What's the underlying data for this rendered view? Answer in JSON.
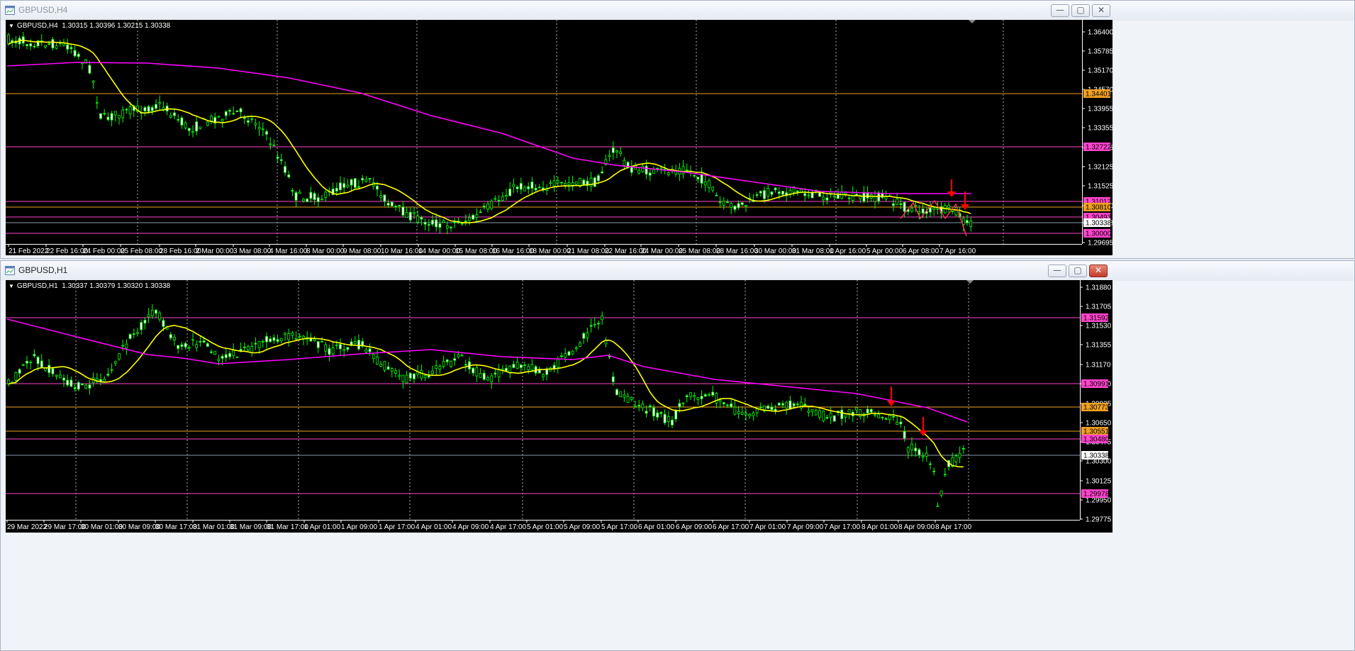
{
  "windows": [
    {
      "title": "GBPUSD,H4",
      "header": "GBPUSD,H4  1.30315 1.30396 1.30215 1.30338",
      "close_glyph": "✕",
      "min_glyph": "—",
      "max_glyph": "▢",
      "price_ticks": [
        "1.36400",
        "1.35785",
        "1.35170",
        "1.34570",
        "1.33955",
        "1.33355",
        "1.32725",
        "1.32125",
        "1.31525",
        "1.30810",
        "1.30338",
        "1.29695"
      ],
      "level_tags": [
        {
          "label": "1.34401",
          "color": "#f0a020"
        },
        {
          "label": "1.32722",
          "color": "#ff44cc"
        },
        {
          "label": "1.31012",
          "color": "#ff44cc"
        },
        {
          "label": "1.30810",
          "color": "#f0a020"
        },
        {
          "label": "1.30493",
          "color": "#ff44cc"
        },
        {
          "label": "1.30338",
          "color": "#ffffff"
        },
        {
          "label": "1.30000",
          "color": "#ff44cc"
        }
      ],
      "time_labels": [
        "21 Feb 2022",
        "22 Feb 16:00",
        "24 Feb 00:00",
        "25 Feb 08:00",
        "28 Feb 16:00",
        "2 Mar 00:00",
        "3 Mar 08:00",
        "4 Mar 16:00",
        "8 Mar 00:00",
        "9 Mar 08:00",
        "10 Mar 16:00",
        "14 Mar 00:00",
        "15 Mar 08:00",
        "16 Mar 16:00",
        "18 Mar 00:00",
        "21 Mar 08:00",
        "22 Mar 16:00",
        "24 Mar 00:00",
        "25 Mar 08:00",
        "28 Mar 16:00",
        "30 Mar 00:00",
        "31 Mar 08:00",
        "1 Apr 16:00",
        "5 Apr 00:00",
        "6 Apr 08:00",
        "7 Apr 16:00"
      ]
    },
    {
      "title": "GBPUSD,H1",
      "header": "GBPUSD,H1  1.30337 1.30379 1.30320 1.30338",
      "close_glyph": "✕",
      "min_glyph": "—",
      "max_glyph": "▢",
      "price_ticks": [
        "1.31880",
        "1.31705",
        "1.31530",
        "1.31355",
        "1.31170",
        "1.31000",
        "1.30825",
        "1.30650",
        "1.30475",
        "1.30300",
        "1.30125",
        "1.29950",
        "1.29775"
      ],
      "level_tags": [
        {
          "label": "1.31592",
          "color": "#ff44cc"
        },
        {
          "label": "1.30991",
          "color": "#ff44cc"
        },
        {
          "label": "1.30773",
          "color": "#f0a020"
        },
        {
          "label": "1.30551",
          "color": "#f0a020"
        },
        {
          "label": "1.30480",
          "color": "#ff44cc"
        },
        {
          "label": "1.30338",
          "color": "#ffffff"
        },
        {
          "label": "1.29978",
          "color": "#ff44cc"
        }
      ],
      "time_labels": [
        "29 Mar 2022",
        "29 Mar 17:00",
        "30 Mar 01:00",
        "30 Mar 09:00",
        "30 Mar 17:00",
        "31 Mar 01:00",
        "31 Mar 09:00",
        "31 Mar 17:00",
        "1 Apr 01:00",
        "1 Apr 09:00",
        "1 Apr 17:00",
        "4 Apr 01:00",
        "4 Apr 09:00",
        "4 Apr 17:00",
        "5 Apr 01:00",
        "5 Apr 09:00",
        "5 Apr 17:00",
        "6 Apr 01:00",
        "6 Apr 09:00",
        "6 Apr 17:00",
        "7 Apr 01:00",
        "7 Apr 09:00",
        "7 Apr 17:00",
        "8 Apr 01:00",
        "8 Apr 09:00",
        "8 Apr 17:00"
      ]
    }
  ],
  "colors": {
    "candle": "#00ff00",
    "ma_fast": "#ffff00",
    "ma_slow": "#ff00ff",
    "arrow": "#ff0000",
    "grid": "#c0c0c0",
    "support_orange": "#f0a020",
    "support_pink": "#ff44cc"
  }
}
